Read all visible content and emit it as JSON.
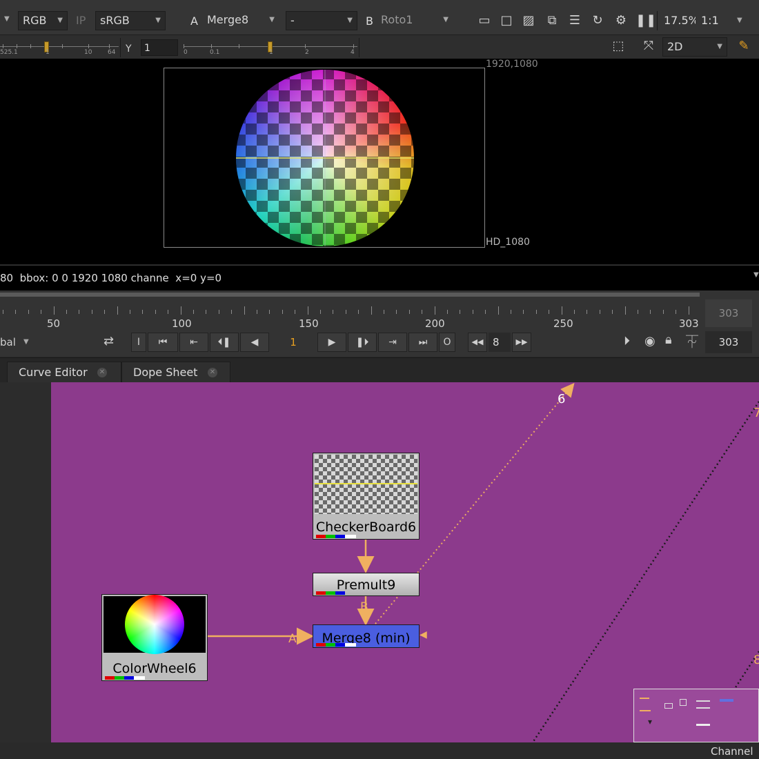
{
  "viewer_toolbar": {
    "channels": "RGB",
    "ip": "IP",
    "colorspace": "sRGB",
    "input_a_letter": "A",
    "input_a": "Merge8",
    "operation": "-",
    "input_b_letter": "B",
    "input_b": "Roto1",
    "zoom": "17.5%",
    "ratio": "1:1",
    "mode": "2D"
  },
  "gain_slider": {
    "labels": [
      "525.1",
      "1",
      "10",
      "64"
    ]
  },
  "gamma": {
    "label": "Y",
    "value": "1",
    "labels": [
      "0",
      "0.1",
      "1",
      "2",
      "4"
    ]
  },
  "viewer": {
    "format_size": "1920,1080",
    "format_name": "HD_1080",
    "info_line": "80  bbox: 0 0 1920 1080 channe  x=0 y=0"
  },
  "timeline": {
    "ticks": [
      "50",
      "100",
      "150",
      "200",
      "250",
      "303"
    ],
    "end_frame": "303",
    "playback_mode": "bal",
    "current_frame": "1",
    "in_label": "I",
    "out_label": "O",
    "increment": "8",
    "end_frame_field": "303"
  },
  "tabs": [
    {
      "label": "Curve Editor"
    },
    {
      "label": "Dope Sheet"
    }
  ],
  "node_graph": {
    "background": "#8c3a8c",
    "nodes": {
      "checkerboard": "CheckerBoard6",
      "premult": "Premult9",
      "merge": "Merge8 (min)",
      "colorwheel": "ColorWheel6"
    },
    "input_a_label": "A",
    "input_b_label": "B",
    "viewer_label_6": "6",
    "viewer_label_7": "7",
    "viewer_label_8": "8",
    "minimap_label": "Channel"
  },
  "colors": {
    "accent_orange": "#f0b060",
    "merge_node": "#4a5ee0",
    "node_gray": "#bdbdbd"
  }
}
